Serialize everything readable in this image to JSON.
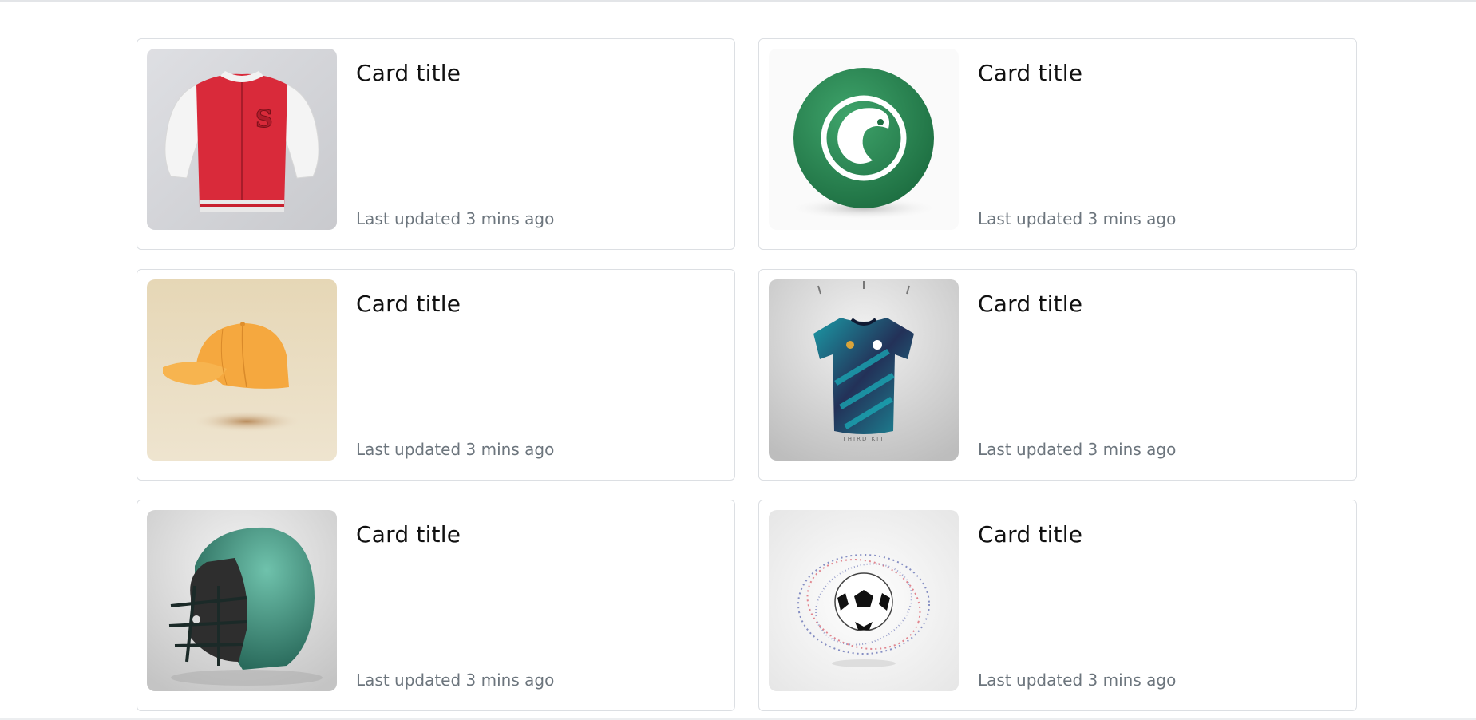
{
  "cards": [
    {
      "title": "Card title",
      "meta": "Last updated 3 mins ago",
      "image": "varsity-jacket"
    },
    {
      "title": "Card title",
      "meta": "Last updated 3 mins ago",
      "image": "green-soccer-ball"
    },
    {
      "title": "Card title",
      "meta": "Last updated 3 mins ago",
      "image": "orange-cap"
    },
    {
      "title": "Card title",
      "meta": "Last updated 3 mins ago",
      "image": "teal-jersey"
    },
    {
      "title": "Card title",
      "meta": "Last updated 3 mins ago",
      "image": "football-helmet"
    },
    {
      "title": "Card title",
      "meta": "Last updated 3 mins ago",
      "image": "soccer-ball-swirl"
    }
  ],
  "colors": {
    "card_border": "#dcdfe3",
    "title": "#111111",
    "meta": "#6c757d"
  }
}
